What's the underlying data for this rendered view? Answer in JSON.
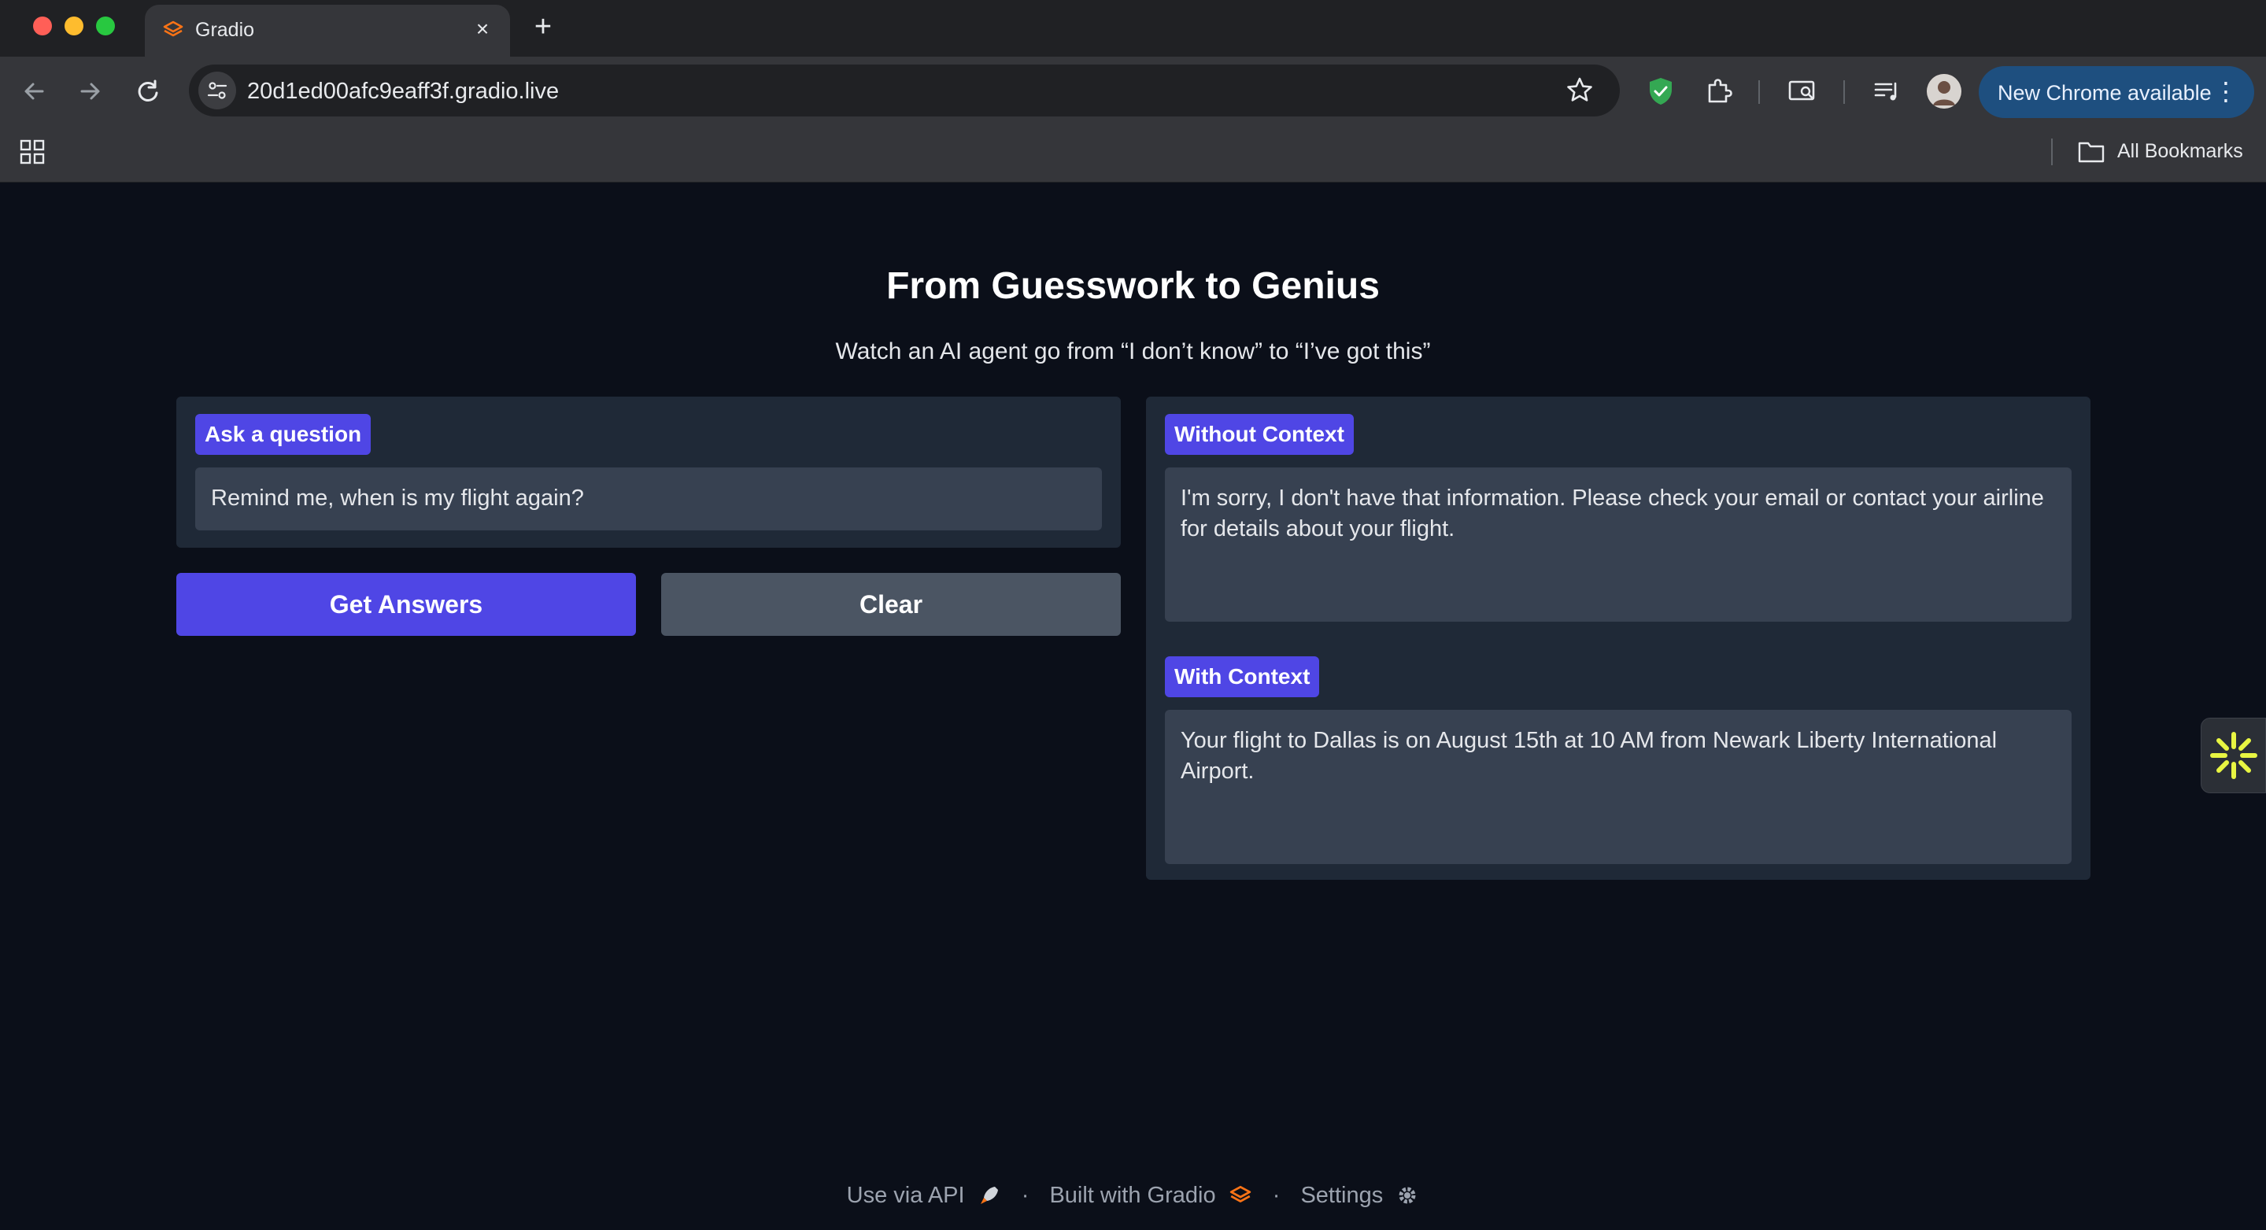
{
  "browser": {
    "tab_title": "Gradio",
    "url": "20d1ed00afc9eaff3f.gradio.live",
    "update_label": "New Chrome available",
    "bookmarks_label": "All Bookmarks"
  },
  "page": {
    "title": "From Guesswork to Genius",
    "subtitle": "Watch an AI agent go from “I don’t know” to “I’ve got this”"
  },
  "question": {
    "label": "Ask a question",
    "value": "Remind me, when is my flight again?"
  },
  "buttons": {
    "submit": "Get Answers",
    "clear": "Clear"
  },
  "outputs": {
    "without_context": {
      "label": "Without Context",
      "value": "I'm sorry, I don't have that information. Please check your email or contact your airline for details about your flight."
    },
    "with_context": {
      "label": "With Context",
      "value": "Your flight to Dallas is on August 15th at 10 AM from Newark Liberty International Airport."
    }
  },
  "footer": {
    "api": "Use via API",
    "built": "Built with Gradio",
    "settings": "Settings",
    "separator": "·"
  },
  "colors": {
    "accent": "#4f46e5",
    "background": "#0b0f19",
    "panel": "#1f2937",
    "field": "#374151"
  }
}
